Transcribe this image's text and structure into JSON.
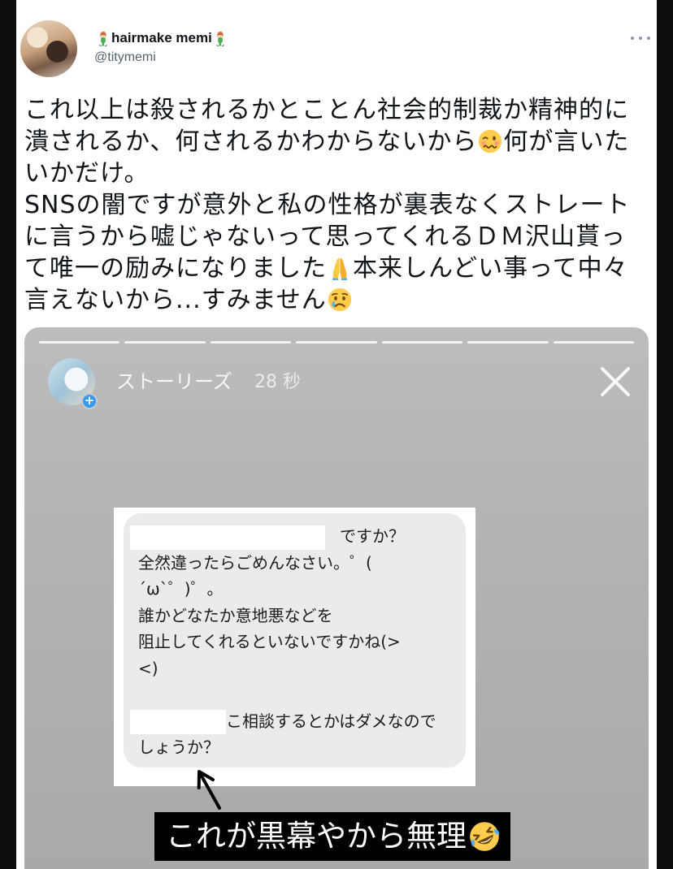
{
  "tweet": {
    "author": {
      "name": "hairmake memi",
      "name_emoji_icon": "mermaid-emoji-icon",
      "handle": "@titymemi"
    },
    "more_icon": "more-horizontal-icon",
    "lines": [
      {
        "text": "これ以上は殺されるかとことん社会的制裁か精神的に"
      },
      {
        "before": "潰されるか、何されるかわからないから",
        "emoji": "woozy-face-emoji-icon",
        "after": "何が言いた"
      },
      {
        "text": "いかだけ。"
      },
      {
        "text": "SNSの闇ですが意外と私の性格が裏表なくストレート"
      },
      {
        "text": "に言うから嘘じゃないって思ってくれるＤＭ沢山貰っ"
      },
      {
        "before": "て唯一の励みになりました",
        "emoji": "folded-hands-emoji-icon",
        "after": "本来しんどい事って中々"
      },
      {
        "before": "言えないから...すみません",
        "emoji": "crying-face-emoji-icon"
      }
    ]
  },
  "story": {
    "title": "ストーリーズ",
    "time": "28 秒",
    "close_icon": "close-icon",
    "message_lines": [
      "ですか？",
      "全然違ったらごめんなさい。゜(",
      "´ω`゜)゜。",
      "誰かどなたか意地悪などを",
      "阻止してくれるといないですかね(>",
      "<)",
      "こ相談するとかはダメなので",
      "しょうか？"
    ],
    "caption": "これが黒幕やから無理",
    "caption_emoji_icon": "rolling-on-floor-laughing-emoji-icon",
    "arrow_icon": "arrow-up-left-icon"
  }
}
